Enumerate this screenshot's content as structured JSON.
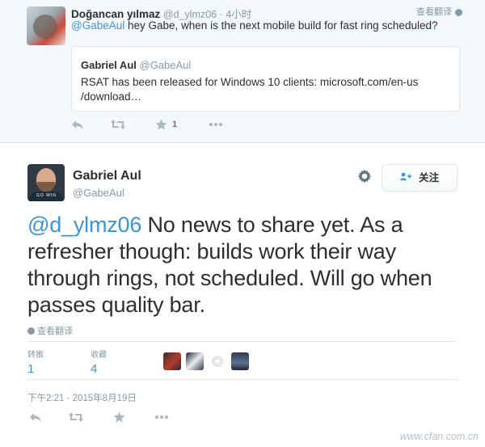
{
  "reply_context": {
    "author_name": "Doğancan yılmaz",
    "author_handle": "@d_ylmz06",
    "time": "· 4小时",
    "translate_label": "查看翻译",
    "text_mention": "@GabeAul",
    "text_body": " hey Gabe, when is the next mobile build for fast ring scheduled?",
    "quote": {
      "author_name": "Gabriel Aul",
      "author_handle": "@GabeAul",
      "text": "RSAT has been released for Windows 10 clients: microsoft.com/en-us /download…"
    },
    "actions": {
      "reply_icon": "reply-icon",
      "retweet_icon": "retweet-icon",
      "favorite_icon": "star-icon",
      "favorite_count": "1",
      "more_icon": "more-icon"
    }
  },
  "tweet": {
    "author_name": "Gabriel Aul",
    "author_handle": "@GabeAul",
    "follow_label": "关注",
    "text_mention": "@d_ylmz06",
    "text_body": " No news to share yet. As a refresher though: builds work their way through rings, not scheduled. Will go when passes quality bar.",
    "translate_label": "查看翻译",
    "stats": {
      "retweets_label": "转推",
      "retweets_value": "1",
      "favorites_label": "收藏",
      "favorites_value": "4"
    },
    "timestamp": "下午2:21 - 2015年8月19日"
  },
  "watermark": {
    "text": "www.cfan.com.cn"
  },
  "colors": {
    "link": "#3b94d9",
    "text": "#292f33",
    "muted": "#8899a6",
    "border": "#e1e8ed",
    "context_bg": "#f5f8fa"
  }
}
